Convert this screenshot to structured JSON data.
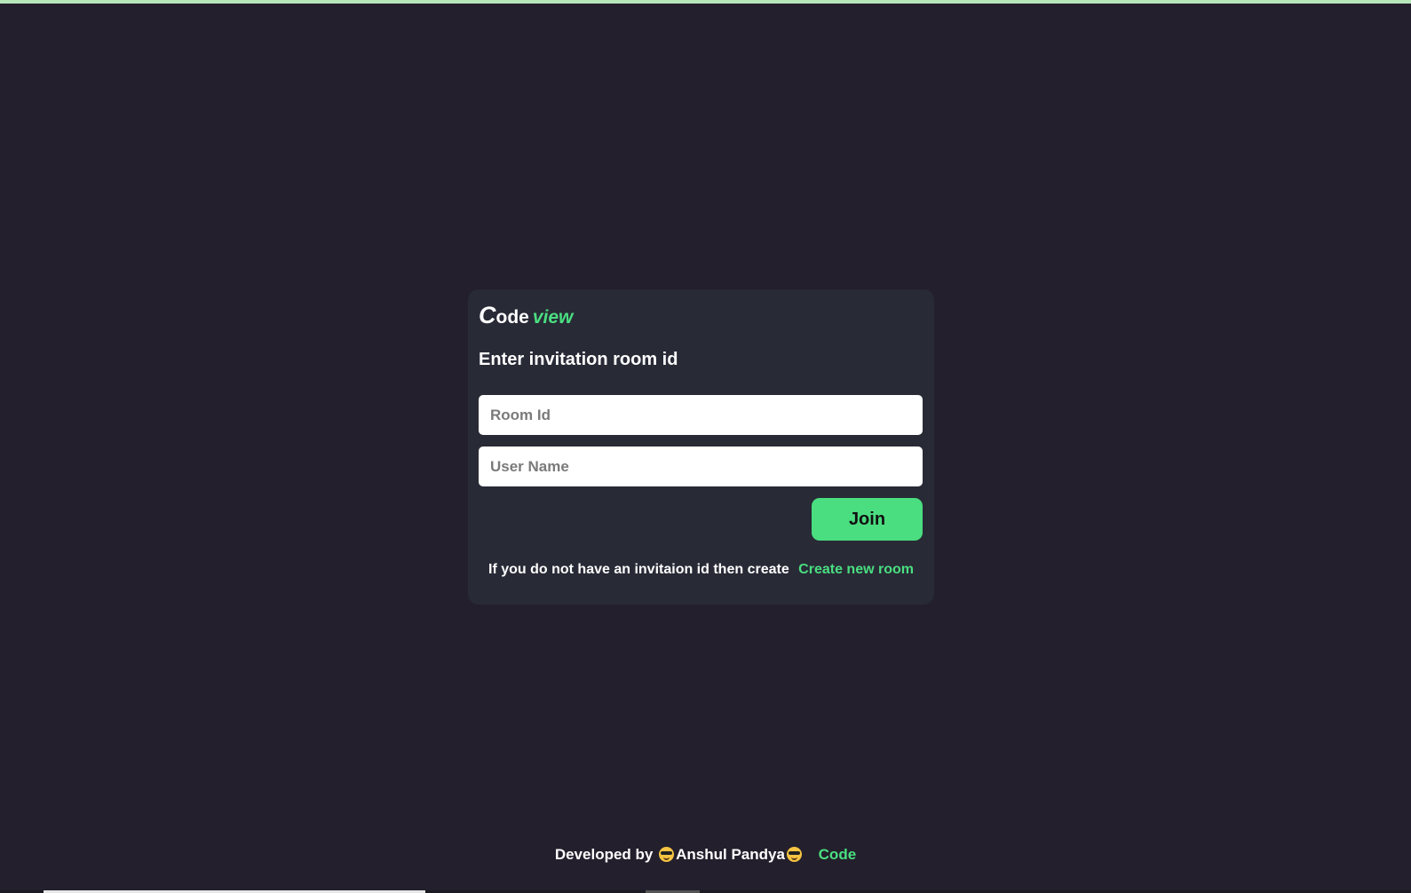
{
  "logo": {
    "first_letter": "C",
    "rest": "ode",
    "accent": "view"
  },
  "form": {
    "heading": "Enter invitation room id",
    "room_id_placeholder": "Room Id",
    "room_id_value": "",
    "user_name_placeholder": "User Name",
    "user_name_value": "",
    "join_label": "Join",
    "create_text": "If you do not have an invitaion id then create",
    "create_link": "Create new room"
  },
  "footer": {
    "developed_by": "Developed by",
    "author": "Anshul Pandya",
    "code_link": "Code",
    "emoji_icon": "sunglasses-face-icon"
  },
  "colors": {
    "background": "#231f2c",
    "card": "#282a36",
    "accent": "#4ade80",
    "top_bar": "#b7e6bb"
  }
}
